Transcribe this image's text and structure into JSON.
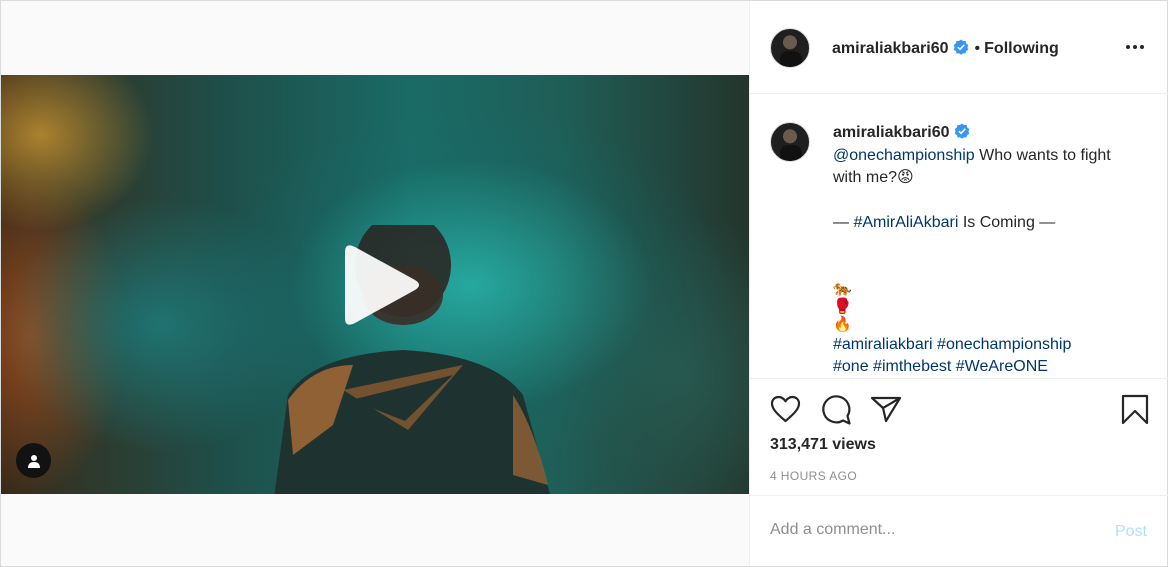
{
  "author": {
    "username": "amiraliakbari60",
    "follow_status": "Following",
    "separator": "•"
  },
  "caption": {
    "username": "amiraliakbari60",
    "mention": "@onechampionship",
    "text1": " Who wants to fight with me?",
    "emoji1": "😡",
    "dash_open": "— ",
    "hashtag_main": "#AmirAliAkbari",
    "text2": " Is Coming —",
    "emoji_lines": [
      "🐅",
      "🥊",
      "🔥"
    ],
    "hashtags_line1": "#amiraliakbari #onechampionship",
    "hashtags_line2": "#one #imthebest #WeAreONE"
  },
  "stats": {
    "views": "313,471 views",
    "time": "4 HOURS AGO"
  },
  "comment": {
    "placeholder": "Add a comment...",
    "post_label": "Post"
  },
  "icons": {
    "like": "heart-icon",
    "comment": "comment-icon",
    "share": "paper-plane-icon",
    "save": "bookmark-icon",
    "play": "play-icon",
    "tag": "user-tag-icon",
    "more": "more-dots-icon",
    "verified": "verified-badge-icon"
  },
  "colors": {
    "link": "#00376b",
    "verified": "#3897f0",
    "post_disabled": "#b2dffc",
    "muted": "#8e8e8e"
  }
}
